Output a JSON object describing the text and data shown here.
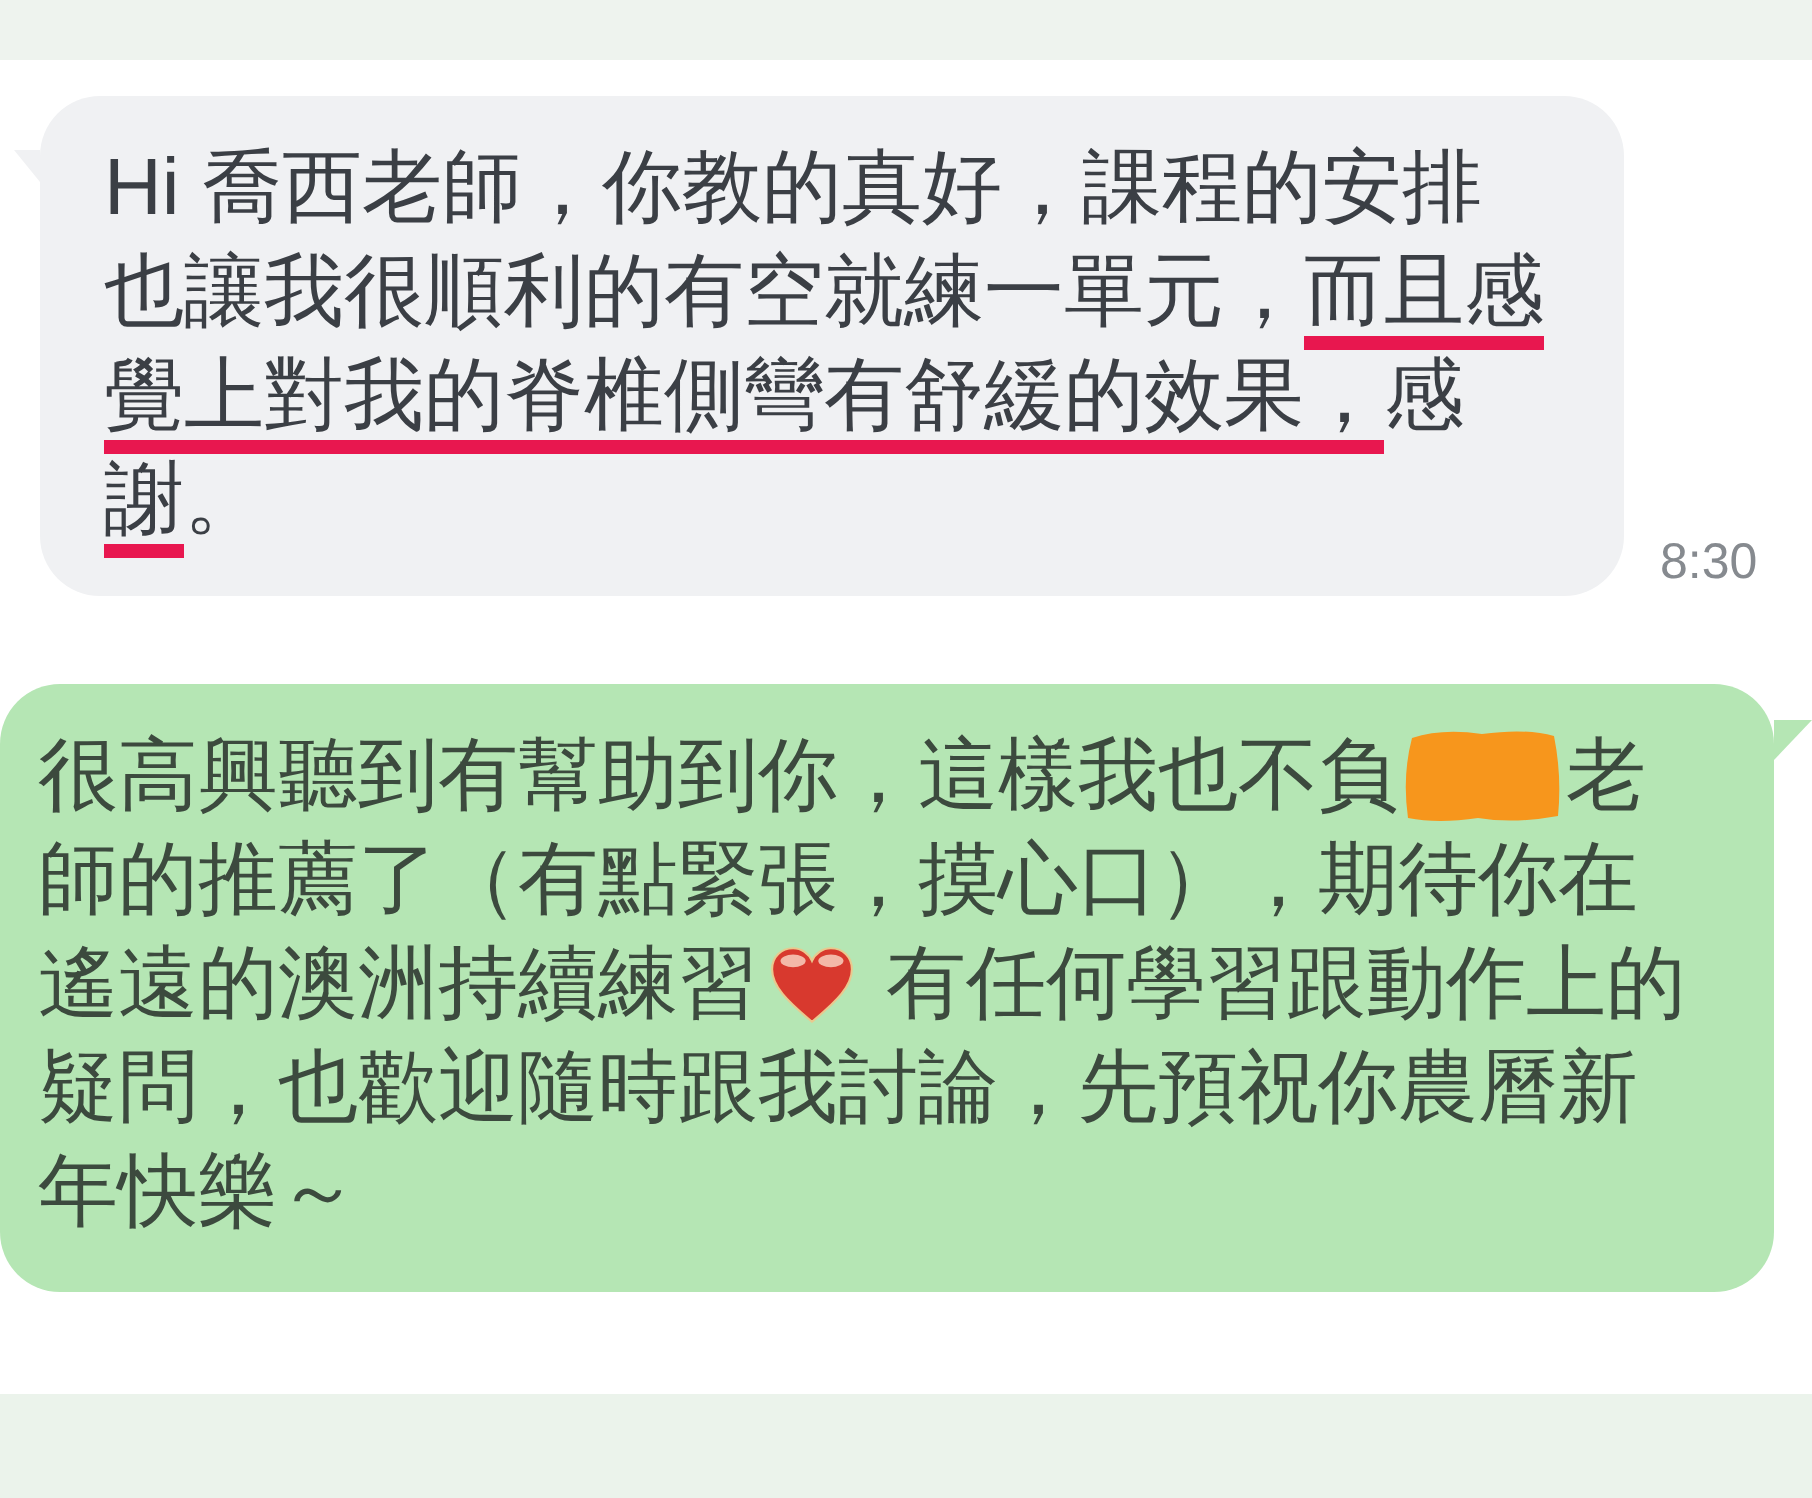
{
  "messages": [
    {
      "kind": "received",
      "lines": [
        [
          {
            "text": "Hi 喬西老師，你教的真好，課程的安排",
            "underlined": false
          }
        ],
        [
          {
            "text": "也讓我很順利的有空就練一單元，",
            "underlined": false
          },
          {
            "text": "而且感",
            "underlined": true
          }
        ],
        [
          {
            "text": "覺上對我的脊椎側彎有舒緩的效果，",
            "underlined": true
          },
          {
            "text": "感",
            "underlined": false
          }
        ],
        [
          {
            "text": "謝",
            "underlined": true
          },
          {
            "text": "。",
            "underlined": false
          }
        ]
      ],
      "time": "8:30"
    },
    {
      "kind": "sent",
      "lines": [
        [
          {
            "kind": "text",
            "text": "很高興聽到有幫助到你，這樣我也不負"
          },
          {
            "kind": "redaction"
          },
          {
            "kind": "text",
            "text": "老"
          }
        ],
        [
          {
            "kind": "text",
            "text": "師的推薦了（有點緊張，摸心口），期待你在"
          }
        ],
        [
          {
            "kind": "text",
            "text": "遙遠的澳洲持續練習"
          },
          {
            "kind": "emoji"
          },
          {
            "kind": "text",
            "text": "有任何學習跟動作上的"
          }
        ],
        [
          {
            "kind": "text",
            "text": "疑問，也歡迎隨時跟我討論，先預祝你農曆新"
          }
        ],
        [
          {
            "kind": "text",
            "text": "年快樂～"
          }
        ]
      ]
    }
  ]
}
